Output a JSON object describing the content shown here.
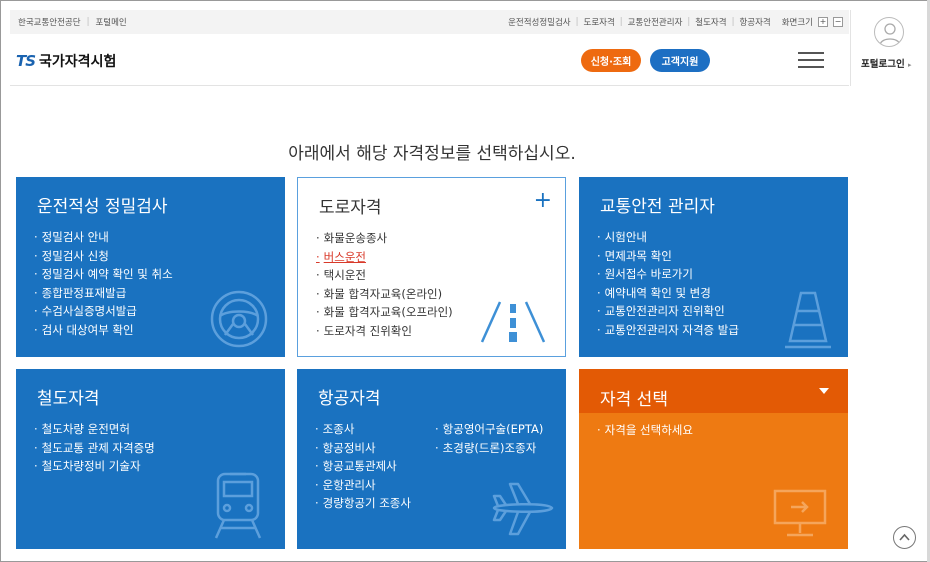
{
  "util_bar": {
    "left_links": [
      "한국교통안전공단",
      "포털메인"
    ],
    "right_links": [
      "운전적성정밀검사",
      "도로자격",
      "교통안전관리자",
      "철도자격",
      "항공자격"
    ],
    "zoom_label": "화면크기",
    "zoom_in": "+",
    "zoom_out": "−"
  },
  "header": {
    "logo_ts": "TS",
    "logo_text": "국가자격시험",
    "apply_label": "신청·조회",
    "support_label": "고객지원",
    "login_label": "포털로그인"
  },
  "main": {
    "headline": "아래에서 해당 자격정보를 선택하십시오."
  },
  "cards": {
    "aptitude": {
      "title": "운전적성 정밀검사",
      "items": [
        "정밀검사 안내",
        "정밀검사 신청",
        "정밀검사 예약 확인 및 취소",
        "종합판정표재발급",
        "수검사실증명서발급",
        "검사 대상여부 확인"
      ]
    },
    "road": {
      "title": "도로자격",
      "plus": "+",
      "items": [
        "화물운송종사",
        "버스운전",
        "택시운전",
        "화물 합격자교육(온라인)",
        "화물 합격자교육(오프라인)",
        "도로자격 진위확인"
      ]
    },
    "safety": {
      "title": "교통안전 관리자",
      "items": [
        "시험안내",
        "면제과목 확인",
        "원서접수 바로가기",
        "예약내역 확인 및 변경",
        "교통안전관리자 진위확인",
        "교통안전관리자 자격증 발급"
      ]
    },
    "rail": {
      "title": "철도자격",
      "items": [
        "철도차량 운전면허",
        "철도교통 관제 자격증명",
        "철도차량정비 기술자"
      ]
    },
    "aviation": {
      "title": "항공자격",
      "items_col1": [
        "조종사",
        "항공정비사",
        "항공교통관제사",
        "운항관리사",
        "경량항공기 조종사"
      ],
      "items_col2": [
        "항공영어구술(EPTA)",
        "초경량(드론)조종자"
      ]
    },
    "select": {
      "title": "자격 선택",
      "items": [
        "자격을 선택하세요"
      ]
    }
  },
  "colors": {
    "blue": "#1a72c0",
    "orange": "#ee7a12",
    "orange_dark": "#e35a05",
    "active_link": "#d83a2a"
  },
  "icons": [
    "steering-wheel-icon",
    "road-icon",
    "traffic-cone-icon",
    "train-icon",
    "airplane-icon",
    "monitor-icon",
    "user-icon",
    "hamburger-icon",
    "chevron-up-icon"
  ]
}
